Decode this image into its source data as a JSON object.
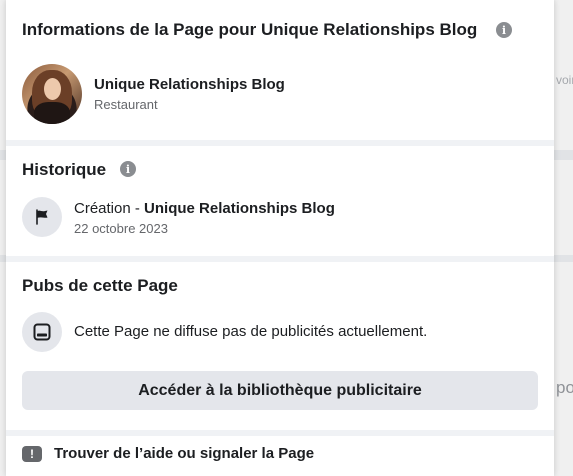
{
  "info_section": {
    "title": "Informations de la Page pour Unique Relationships Blog",
    "page_name": "Unique Relationships Blog",
    "page_category": "Restaurant"
  },
  "history_section": {
    "title": "Historique",
    "event_prefix": "Création - ",
    "event_name": "Unique Relationships Blog",
    "event_date": "22 octobre 2023"
  },
  "ads_section": {
    "title": "Pubs de cette Page",
    "status_text": "Cette Page ne diffuse pas de publicités actuellement.",
    "library_button_label": "Accéder à la bibliothèque publicitaire"
  },
  "help_section": {
    "link_label": "Trouver de l’aide ou signaler la Page"
  },
  "background": {
    "partial_text_right_1": "voir",
    "partial_text_right_2": "po"
  },
  "icons": {
    "info": "info-icon",
    "flag": "flag-icon",
    "ads": "ad-icon",
    "help": "exclamation-icon"
  }
}
